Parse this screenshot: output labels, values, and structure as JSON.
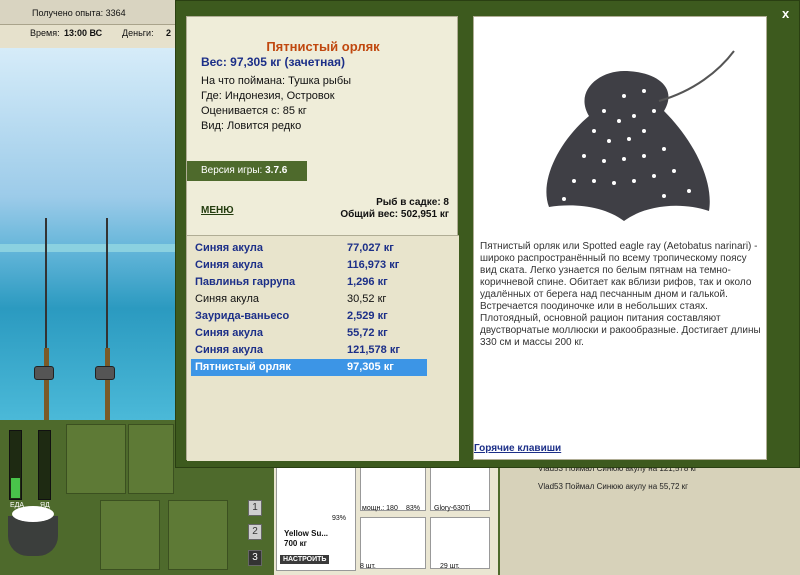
{
  "topbar": {
    "xp": "Получено опыта: 3364",
    "time_label": "Время:",
    "time_value": "13:00 ВС",
    "money_label": "Деньги:",
    "money_value": "2"
  },
  "needs": {
    "eat_label": "ЕДА",
    "poison_label": "ЯД",
    "eat_level": 0.3,
    "poison_level": 0.0
  },
  "modal": {
    "close": "x",
    "fish_name": "Пятнистый орляк",
    "weight": "Вес: 97,305 кг (зачетная)",
    "bait": "На что поймана: Тушка рыбы",
    "where": "Где: Индонезия, Островок",
    "valued": "Оценивается с: 85 кг",
    "kind": "Вид: Ловится редко",
    "version_label": "Версия игры:",
    "version_value": "3.7.6",
    "menu": "МЕНЮ",
    "catch_count": "Рыб в садке: 8",
    "total_weight": "Общий вес: 502,951 кг",
    "catch": [
      {
        "name": "Синяя акула",
        "weight": "77,027 кг",
        "bold": true
      },
      {
        "name": "Синяя акула",
        "weight": "116,973 кг",
        "bold": true
      },
      {
        "name": "Павлинья гаррупа",
        "weight": "1,296 кг",
        "bold": true
      },
      {
        "name": "Синяя акула",
        "weight": "30,52 кг",
        "bold": false
      },
      {
        "name": "Заурида-ваньесо",
        "weight": "2,529 кг",
        "bold": true
      },
      {
        "name": "Синяя акула",
        "weight": "55,72 кг",
        "bold": true
      },
      {
        "name": "Синяя акула",
        "weight": "121,578 кг",
        "bold": true
      },
      {
        "name": "Пятнистый орляк",
        "weight": "97,305 кг",
        "selected": true
      }
    ],
    "description": "Пятнистый орляк или Spotted eagle ray (Aetobatus narinari) - широко распространённый по всему тропическому поясу вид ската. Легко узнается по белым пятнам на темно-коричневой спине. Обитает как вблизи рифов, так и около удалённых от берега над песчанным дном и галькой. Встречается поодиночке или в небольших стаях. Плотоядный, основной рацион питания составляют двустворчатые моллюски и ракообразные. Достигает длины 330 см и массы 200 кг.",
    "hotkeys": "Горячие клавиши"
  },
  "inventory": {
    "rod_name": "Yellow Su...",
    "rod_weight": "700 кг",
    "rod_percent": "93%",
    "setup": "НАСТРОИТЬ",
    "reel_power": "мощн.: 180",
    "reel_percent": "83%",
    "reel_item": "Glory-630Ti",
    "hooks_count": "8 шт.",
    "bait_count": "29 шт.",
    "slot_numbers": [
      "1",
      "2",
      "3"
    ]
  },
  "feed": [
    "Vlad53 Поймал Синюю акулу на 121,578 кг",
    "Vlad53 Поймал Синюю акулу на 55,72 кг"
  ]
}
